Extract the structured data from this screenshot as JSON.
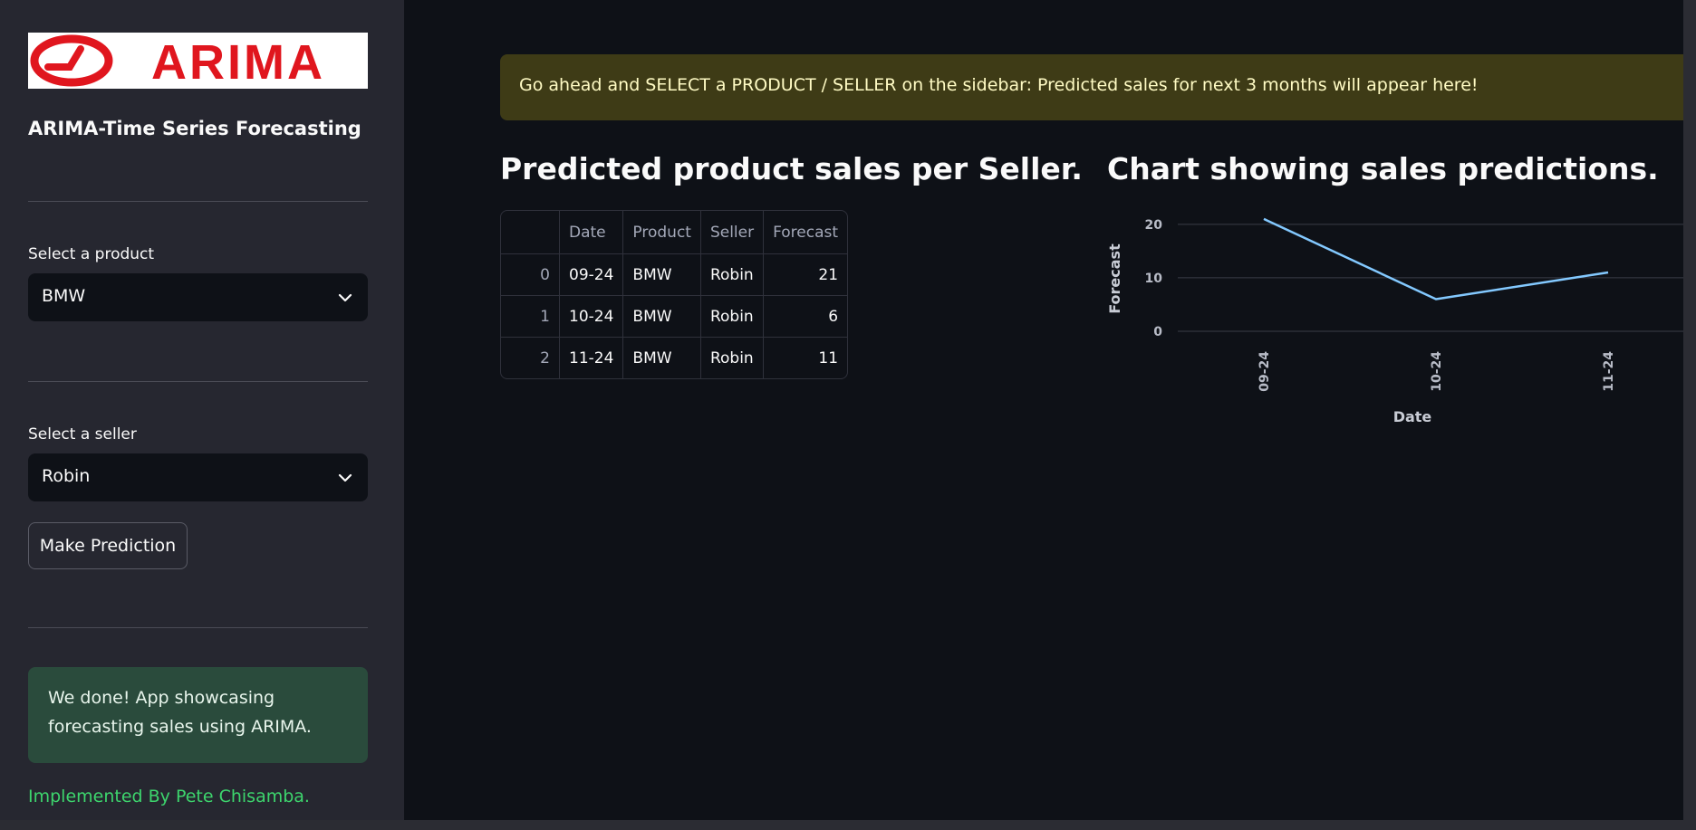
{
  "sidebar": {
    "logo_text": "ARIMA",
    "title": "ARIMA-Time Series Forecasting",
    "product_label": "Select a product",
    "product_value": "BMW",
    "seller_label": "Select a seller",
    "seller_value": "Robin",
    "predict_button": "Make Prediction",
    "success_message": "We done! App showcasing forecasting sales using ARIMA.",
    "credit": "Implemented By Pete Chisamba."
  },
  "main": {
    "info_message": "Go ahead and SELECT a PRODUCT / SELLER on the sidebar: Predicted sales for next 3 months will appear here!",
    "table_heading": "Predicted product sales per Seller.",
    "chart_heading": "Chart showing sales predictions.",
    "table": {
      "columns": [
        "",
        "Date",
        "Product",
        "Seller",
        "Forecast"
      ],
      "rows": [
        [
          "0",
          "09-24",
          "BMW",
          "Robin",
          "21"
        ],
        [
          "1",
          "10-24",
          "BMW",
          "Robin",
          "6"
        ],
        [
          "2",
          "11-24",
          "BMW",
          "Robin",
          "11"
        ]
      ]
    }
  },
  "colors": {
    "sidebar_bg": "#262730",
    "main_bg": "#0e1117",
    "info_bg": "#3e3b16",
    "success_bg": "#2a4b3c",
    "line": "#83c9ff",
    "logo_red": "#e0161e"
  },
  "chart_data": {
    "type": "line",
    "categories": [
      "09-24",
      "10-24",
      "11-24"
    ],
    "series": [
      {
        "values": [
          21,
          6,
          11
        ]
      }
    ],
    "xlabel": "Date",
    "ylabel": "Forecast",
    "yticks": [
      0,
      10,
      20
    ],
    "ylim": [
      0,
      22
    ],
    "grid": true
  }
}
